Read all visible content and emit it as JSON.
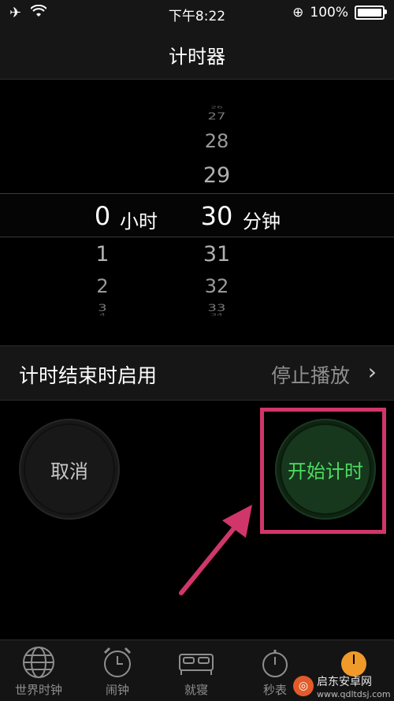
{
  "status": {
    "time": "下午8:22",
    "battery": "100%"
  },
  "nav": {
    "title": "计时器"
  },
  "picker": {
    "hours": {
      "above": [],
      "selected": "0",
      "below": [
        "1",
        "2",
        "3",
        "4"
      ],
      "unit": "小时"
    },
    "minutes": {
      "above": [
        "26",
        "27",
        "28",
        "29"
      ],
      "selected": "30",
      "below": [
        "31",
        "32",
        "33",
        "34"
      ],
      "unit": "分钟"
    }
  },
  "setting": {
    "label": "计时结束时启用",
    "value": "停止播放"
  },
  "buttons": {
    "cancel": "取消",
    "start": "开始计时"
  },
  "tabs": [
    "世界时钟",
    "闹钟",
    "就寝",
    "秒表"
  ],
  "watermark": {
    "title": "启东安卓网",
    "url": "www.qdltdsj.com"
  }
}
